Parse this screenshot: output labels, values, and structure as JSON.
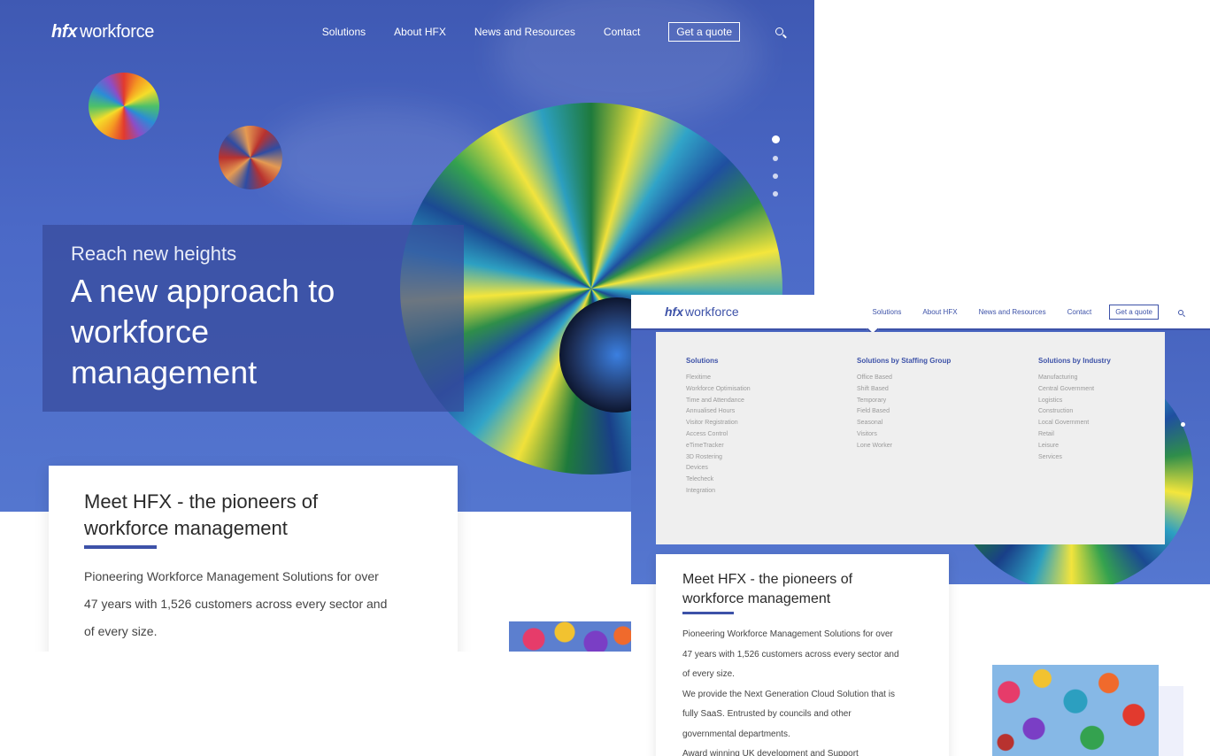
{
  "brand": {
    "logo_bold": "hfx",
    "logo_text": "workforce",
    "accent": "#3d52a8"
  },
  "nav": {
    "items": [
      "Solutions",
      "About HFX",
      "News and Resources",
      "Contact"
    ],
    "quote_label": "Get a quote"
  },
  "hero": {
    "kicker": "Reach new heights",
    "headline": "A new approach to workforce management",
    "slide_count": 4,
    "active_slide": 1
  },
  "meet": {
    "title": "Meet HFX - the pioneers of workforce management",
    "lines": [
      "Pioneering Workforce Management Solutions for over",
      "47 years with 1,526 customers across every sector and",
      "of every size."
    ],
    "lines_small": [
      "Pioneering Workforce Management Solutions for over",
      "47 years with 1,526 customers across every sector and",
      "of every size.",
      "We provide the Next Generation Cloud Solution that is",
      "fully SaaS. Entrusted by councils and other",
      "governmental departments.",
      "Award winning UK development and Support"
    ]
  },
  "mega_menu": {
    "columns": [
      {
        "heading": "Solutions",
        "items": [
          "Flexitime",
          "Workforce Optimisation",
          "Time and Attendance",
          "Annualised Hours",
          "Visitor Registration",
          "Access Control",
          "eTimeTracker",
          "3D Rostering",
          "Devices",
          "Telecheck",
          "Integration"
        ]
      },
      {
        "heading": "Solutions by Staffing Group",
        "items": [
          "Office Based",
          "Shift Based",
          "Temporary",
          "Field Based",
          "Seasonal",
          "Visitors",
          "Lone Worker"
        ]
      },
      {
        "heading": "Solutions by Industry",
        "items": [
          "Manufacturing",
          "Central Government",
          "Logistics",
          "Construction",
          "Local Government",
          "Retail",
          "Leisure",
          "Services"
        ]
      }
    ]
  }
}
